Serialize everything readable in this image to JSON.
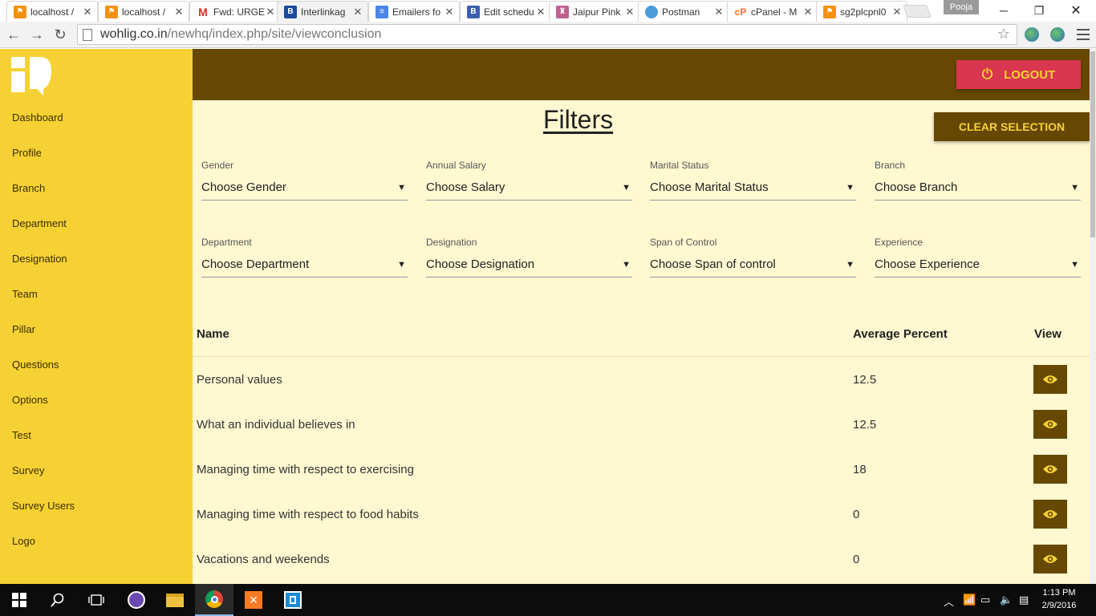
{
  "browser": {
    "tabs": [
      {
        "label": "localhost /",
        "favicon": "pma-icon"
      },
      {
        "label": "localhost /",
        "favicon": "pma-icon"
      },
      {
        "label": "Fwd: URGE",
        "favicon": "gmail-icon"
      },
      {
        "label": "Interlinkag",
        "favicon": "b-icon"
      },
      {
        "label": "Emailers fo",
        "favicon": "docs-icon"
      },
      {
        "label": "Edit schedu",
        "favicon": "b-icon"
      },
      {
        "label": "Jaipur Pink",
        "favicon": "jaipur-icon"
      },
      {
        "label": "Postman",
        "favicon": "globe-icon"
      },
      {
        "label": "cPanel - M",
        "favicon": "cpanel-icon"
      },
      {
        "label": "sg2plcpnl0",
        "favicon": "pma-icon"
      }
    ],
    "profile_name": "Pooja",
    "url_host": "wohlig.co.in",
    "url_path": "/newhq/index.php/site/viewconclusion"
  },
  "sidebar": {
    "items": [
      {
        "label": "Dashboard"
      },
      {
        "label": "Profile"
      },
      {
        "label": "Branch"
      },
      {
        "label": "Department"
      },
      {
        "label": "Designation"
      },
      {
        "label": "Team"
      },
      {
        "label": "Pillar"
      },
      {
        "label": "Questions"
      },
      {
        "label": "Options"
      },
      {
        "label": "Test"
      },
      {
        "label": "Survey"
      },
      {
        "label": "Survey Users"
      },
      {
        "label": "Logo"
      }
    ]
  },
  "header": {
    "logout_label": "LOGOUT"
  },
  "filters": {
    "title": "Filters",
    "clear_label": "CLEAR SELECTION",
    "fields": [
      {
        "label": "Gender",
        "value": "Choose Gender"
      },
      {
        "label": "Annual Salary",
        "value": "Choose Salary"
      },
      {
        "label": "Marital Status",
        "value": "Choose Marital Status"
      },
      {
        "label": "Branch",
        "value": "Choose Branch"
      },
      {
        "label": "Department",
        "value": "Choose Department"
      },
      {
        "label": "Designation",
        "value": "Choose Designation"
      },
      {
        "label": "Span of Control",
        "value": "Choose Span of control"
      },
      {
        "label": "Experience",
        "value": "Choose Experience"
      }
    ]
  },
  "table": {
    "columns": {
      "name": "Name",
      "average": "Average Percent",
      "view": "View"
    },
    "rows": [
      {
        "name": "Personal values",
        "average": "12.5"
      },
      {
        "name": "What an individual believes in",
        "average": "12.5"
      },
      {
        "name": "Managing time with respect to exercising",
        "average": "18"
      },
      {
        "name": "Managing time with respect to food habits",
        "average": "0"
      },
      {
        "name": "Vacations and weekends",
        "average": "0"
      }
    ]
  },
  "taskbar": {
    "time": "1:13 PM",
    "date": "2/9/2016"
  },
  "colors": {
    "sidebar": "#f6d133",
    "topbar": "#664803",
    "content_bg": "#fff8d1",
    "logout": "#d8374f",
    "accent_text": "#f6d133"
  }
}
